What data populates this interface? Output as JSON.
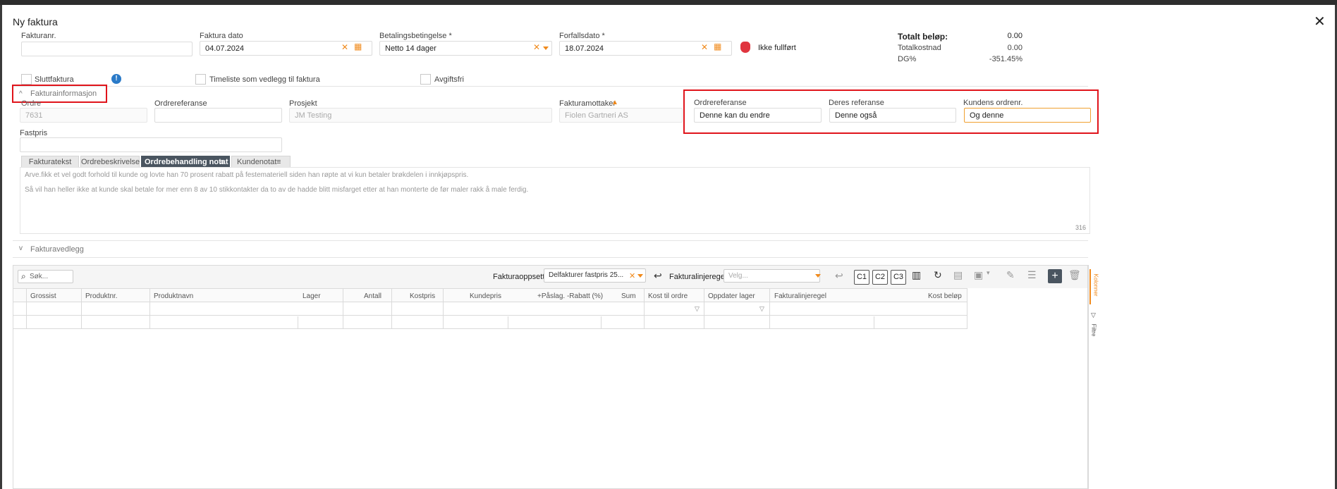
{
  "dialog": {
    "title": "Ny faktura"
  },
  "header": {
    "invoice_no": {
      "label": "Fakturanr.",
      "value": ""
    },
    "invoice_date": {
      "label": "Faktura dato",
      "value": "04.07.2024"
    },
    "payment_terms": {
      "label": "Betalingsbetingelse *",
      "value": "Netto 14 dager"
    },
    "due_date": {
      "label": "Forfallsdato *",
      "value": "18.07.2024"
    },
    "status": "Ikke fullført"
  },
  "totals": {
    "total_label": "Totalt beløp:",
    "total_value": "0.00",
    "cost_label": "Totalkostnad",
    "cost_value": "0.00",
    "dg_label": "DG%",
    "dg_value": "-351.45%"
  },
  "checkboxes": {
    "final_invoice": "Sluttfaktura",
    "timesheet_attach": "Timeliste som vedlegg til faktura",
    "tax_free": "Avgiftsfri"
  },
  "section_info": {
    "title": "Fakturainformasjon",
    "order": {
      "label": "Ordre",
      "value": "7631"
    },
    "order_ref": {
      "label": "Ordrereferanse",
      "value": ""
    },
    "project": {
      "label": "Prosjekt",
      "value": "JM Testing"
    },
    "recipient": {
      "label": "Fakturamottaker",
      "value": "Fiolen Gartneri AS"
    },
    "order_ref2": {
      "label": "Ordrereferanse",
      "value": "Denne kan du endre"
    },
    "their_ref": {
      "label": "Deres referanse",
      "value": "Denne også"
    },
    "customer_order_no": {
      "label": "Kundens ordrenr.",
      "value": "Og denne"
    },
    "fixed_price": {
      "label": "Fastpris",
      "value": ""
    }
  },
  "tabs": [
    "Fakturatekst",
    "Ordrebeskrivelse",
    "Ordrebehandling notat",
    "Kundenotat"
  ],
  "note": {
    "line1": "Arve.fikk et vel godt forhold til kunde og lovte han 70 prosent rabatt på festemateriell siden han røpte at vi kun betaler brøkdelen i innkjøpspris.",
    "line2": "Så vil han heller ikke at kunde skal betale for mer enn 8 av 10 stikkontakter da to av de hadde blitt misfarget etter at han monterte de før maler rakk å male ferdig.",
    "count": "316"
  },
  "section_attach": {
    "title": "Fakturavedlegg"
  },
  "toolbar": {
    "search_placeholder": "Søk...",
    "setup_label": "Fakturaoppsett:",
    "setup_value": "Delfakturer fastpris 25...",
    "rule_label": "Fakturalinjeregel",
    "rule_placeholder": "Velg...",
    "c1": "C1",
    "c2": "C2",
    "c3": "C3"
  },
  "table": {
    "columns": [
      "Grossist",
      "Produktnr.",
      "Produktnavn",
      "Lager",
      "Antall",
      "Kostpris",
      "Kundepris",
      "+Påslag. -Rabatt (%)",
      "Sum",
      "Kost til ordre",
      "Oppdater lager",
      "Fakturalinjeregel",
      "Kost beløp"
    ]
  },
  "side_tabs": {
    "columns": "Kolonner",
    "filters": "Filtre"
  }
}
